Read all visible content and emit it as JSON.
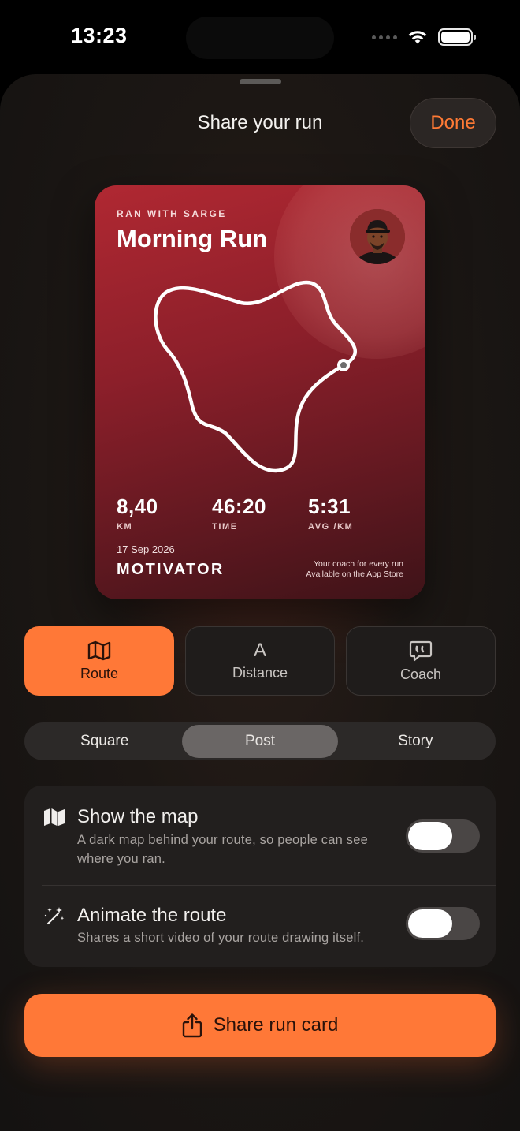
{
  "status_bar": {
    "time": "13:23"
  },
  "sheet": {
    "title": "Share your run",
    "done_label": "Done"
  },
  "run_card": {
    "kicker": "RAN WITH SARGE",
    "title": "Morning Run",
    "stats": [
      {
        "value": "8,40",
        "label": "KM"
      },
      {
        "value": "46:20",
        "label": "TIME"
      },
      {
        "value": "5:31",
        "label": "AVG /KM"
      }
    ],
    "date": "17 Sep 2026",
    "brand": "MOTIVATOR",
    "tagline_1": "Your coach for every run",
    "tagline_2": "Available on the App Store"
  },
  "modes": [
    {
      "label": "Route",
      "icon": "map-icon",
      "selected": true
    },
    {
      "label": "Distance",
      "icon": "letter-a-icon",
      "glyph": "A",
      "selected": false
    },
    {
      "label": "Coach",
      "icon": "speech-bubble-quote-icon",
      "selected": false
    }
  ],
  "formats": {
    "options": [
      "Square",
      "Post",
      "Story"
    ],
    "selected": "Post"
  },
  "settings": [
    {
      "title": "Show the map",
      "description": "A dark map behind your route, so people can see where you ran.",
      "icon": "map-icon",
      "enabled": false
    },
    {
      "title": "Animate the route",
      "description": "Shares a short video of your route drawing itself.",
      "icon": "magic-wand-icon",
      "enabled": false
    }
  ],
  "share_button": {
    "label": "Share run card",
    "icon": "share-icon"
  },
  "colors": {
    "accent": "#FF7837",
    "card_red": "#B02832",
    "background": "#1C1714"
  }
}
